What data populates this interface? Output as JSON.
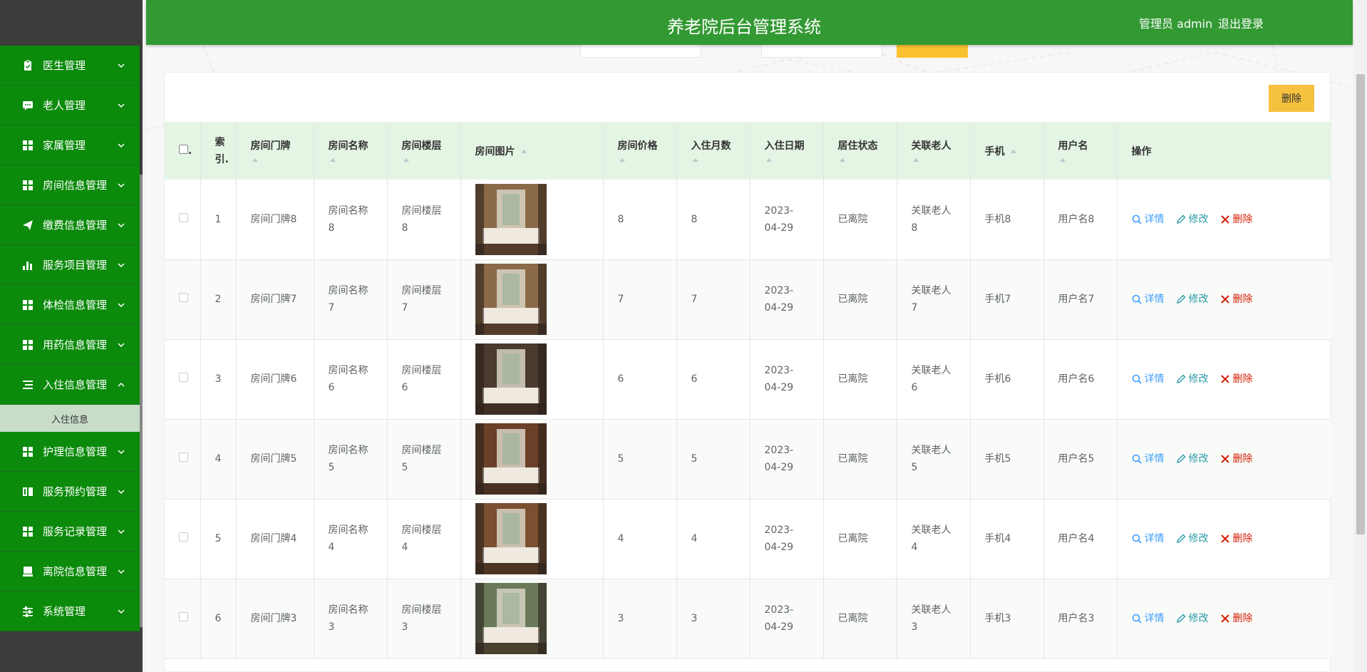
{
  "header": {
    "title": "养老院后台管理系统",
    "user_label": "管理员 admin",
    "logout_label": "退出登录"
  },
  "sidebar": {
    "items": [
      {
        "label": "医生管理",
        "icon": "clipboard-icon"
      },
      {
        "label": "老人管理",
        "icon": "chat-icon"
      },
      {
        "label": "家属管理",
        "icon": "grid-icon"
      },
      {
        "label": "房间信息管理",
        "icon": "grid-icon"
      },
      {
        "label": "缴费信息管理",
        "icon": "send-icon"
      },
      {
        "label": "服务项目管理",
        "icon": "bar-chart-icon"
      },
      {
        "label": "体检信息管理",
        "icon": "grid-icon"
      },
      {
        "label": "用药信息管理",
        "icon": "grid-icon"
      },
      {
        "label": "入住信息管理",
        "icon": "list-icon",
        "expanded": true
      },
      {
        "label": "护理信息管理",
        "icon": "grid-icon"
      },
      {
        "label": "服务预约管理",
        "icon": "book-icon"
      },
      {
        "label": "服务记录管理",
        "icon": "grid-icon"
      },
      {
        "label": "离院信息管理",
        "icon": "monitor-icon"
      },
      {
        "label": "系统管理",
        "icon": "sliders-icon"
      }
    ],
    "submenu": {
      "label": "入住信息"
    }
  },
  "toolbar": {
    "delete_label": "删除"
  },
  "table": {
    "headers": {
      "select": ".",
      "index": "索引.",
      "room_no": "房间门牌",
      "room_name": "房间名称",
      "floor": "房间楼层",
      "photo": "房间图片",
      "price": "房间价格",
      "months": "入住月数",
      "date": "入住日期",
      "status": "居住状态",
      "elder": "关联老人",
      "phone": "手机",
      "username": "用户名",
      "actions": "操作"
    },
    "action_labels": {
      "detail": "详情",
      "edit": "修改",
      "delete": "删除"
    },
    "rows": [
      {
        "index": "1",
        "room_no": "房间门牌8",
        "room_name": "房间名称8",
        "floor": "房间楼层8",
        "price": "8",
        "months": "8",
        "date": "2023-04-29",
        "status": "已离院",
        "elder": "关联老人8",
        "phone": "手机8",
        "username": "用户名8",
        "photo_tone": "#8a6a48"
      },
      {
        "index": "2",
        "room_no": "房间门牌7",
        "room_name": "房间名称7",
        "floor": "房间楼层7",
        "price": "7",
        "months": "7",
        "date": "2023-04-29",
        "status": "已离院",
        "elder": "关联老人7",
        "phone": "手机7",
        "username": "用户名7",
        "photo_tone": "#8a6a48"
      },
      {
        "index": "3",
        "room_no": "房间门牌6",
        "room_name": "房间名称6",
        "floor": "房间楼层6",
        "price": "6",
        "months": "6",
        "date": "2023-04-29",
        "status": "已离院",
        "elder": "关联老人6",
        "phone": "手机6",
        "username": "用户名6",
        "photo_tone": "#4a3a30"
      },
      {
        "index": "4",
        "room_no": "房间门牌5",
        "room_name": "房间名称5",
        "floor": "房间楼层5",
        "price": "5",
        "months": "5",
        "date": "2023-04-29",
        "status": "已离院",
        "elder": "关联老人5",
        "phone": "手机5",
        "username": "用户名5",
        "photo_tone": "#6a4028"
      },
      {
        "index": "5",
        "room_no": "房间门牌4",
        "room_name": "房间名称4",
        "floor": "房间楼层4",
        "price": "4",
        "months": "4",
        "date": "2023-04-29",
        "status": "已离院",
        "elder": "关联老人4",
        "phone": "手机4",
        "username": "用户名4",
        "photo_tone": "#7a5030"
      },
      {
        "index": "6",
        "room_no": "房间门牌3",
        "room_name": "房间名称3",
        "floor": "房间楼层3",
        "price": "3",
        "months": "3",
        "date": "2023-04-29",
        "status": "已离院",
        "elder": "关联老人3",
        "phone": "手机3",
        "username": "用户名3",
        "photo_tone": "#6a7a58"
      }
    ]
  },
  "colors": {
    "header_bg": "#339933",
    "menu_bg": "#0b8a0b",
    "table_header_bg": "#e4f5e4",
    "delete_button": "#f5c13e"
  }
}
